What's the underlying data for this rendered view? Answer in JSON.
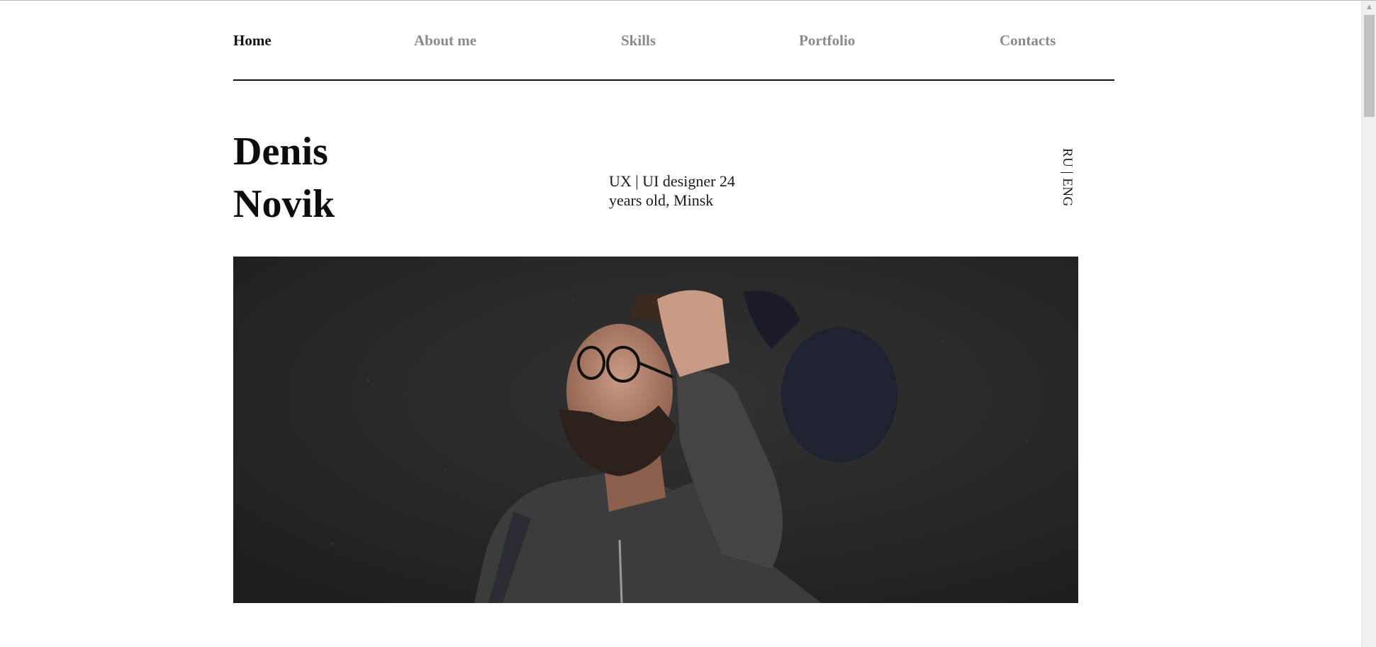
{
  "nav": {
    "items": [
      {
        "label": "Home",
        "active": true
      },
      {
        "label": "About me",
        "active": false
      },
      {
        "label": "Skills",
        "active": false
      },
      {
        "label": "Portfolio",
        "active": false
      },
      {
        "label": "Contacts",
        "active": false
      }
    ]
  },
  "hero": {
    "first_name": "Denis",
    "last_name": "Novik",
    "tagline_line1": "UX | UI designer 24",
    "tagline_line2": "years old, Minsk",
    "language_switch": "RU | ENG"
  },
  "scrollbar": {
    "up_arrow_icon": "triangle-up-icon"
  },
  "colors": {
    "nav_active": "#111111",
    "nav_inactive": "#8a8a8a",
    "photo_background": "#262626"
  }
}
